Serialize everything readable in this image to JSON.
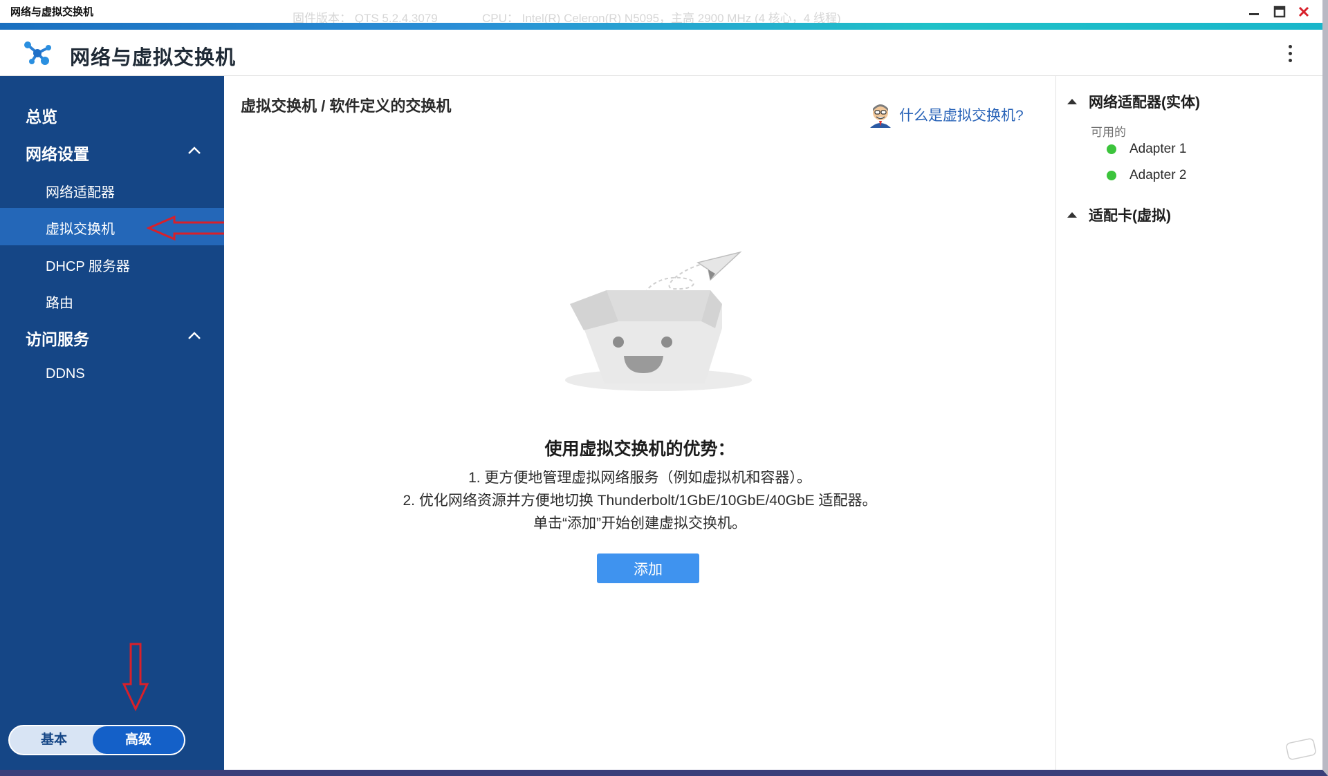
{
  "window": {
    "title": "网络与虚拟交换机",
    "ghost_firmware": "固件版本： QTS 5.2.4.3079",
    "ghost_cpu": "CPU： Intel(R) Celeron(R) N5095，主高 2900 MHz (4 核心，4 线程)"
  },
  "header": {
    "app_title": "网络与虚拟交换机"
  },
  "sidebar": {
    "overview": "总览",
    "network_settings": {
      "label": "网络设置",
      "items": [
        "网络适配器",
        "虚拟交换机",
        "DHCP 服务器",
        "路由"
      ]
    },
    "access_services": {
      "label": "访问服务",
      "items": [
        "DDNS"
      ]
    },
    "active_item": "虚拟交换机",
    "mode_toggle": {
      "basic": "基本",
      "advanced": "高级",
      "selected": "高级"
    }
  },
  "main": {
    "breadcrumb": "虚拟交换机 / 软件定义的交换机",
    "help_link": "什么是虚拟交换机?",
    "advantages_title": "使用虚拟交换机的优势：",
    "advantages_lines": [
      "1. 更方便地管理虚拟网络服务（例如虚拟机和容器）。",
      "2. 优化网络资源并方便地切换 Thunderbolt/1GbE/10GbE/40GbE 适配器。",
      "单击“添加”开始创建虚拟交换机。"
    ],
    "add_button": "添加"
  },
  "right_panel": {
    "physical_section": "网络适配器(实体)",
    "available_label": "可用的",
    "adapters": [
      {
        "name": "Adapter 1",
        "status_color": "#3cc43c"
      },
      {
        "name": "Adapter 2",
        "status_color": "#3cc43c"
      }
    ],
    "virtual_section": "适配卡(虚拟)"
  },
  "colors": {
    "sidebar_bg": "#154686",
    "sidebar_active": "#2467b8",
    "primary_button": "#3f93ef",
    "link": "#2a64b8",
    "annotation_arrow": "#d8202a"
  },
  "icons": {
    "app_logo": "network-switch-icon",
    "help": "helper-avatar-icon",
    "window_controls": [
      "minimize-icon",
      "maximize-icon",
      "close-icon"
    ]
  }
}
